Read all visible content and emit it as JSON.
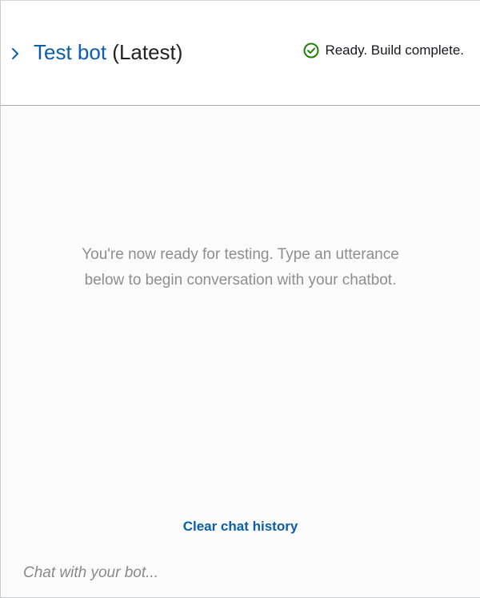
{
  "header": {
    "title_link": "Test bot",
    "title_version": "(Latest)",
    "status_text": "Ready. Build complete.",
    "icons": {
      "expand": "chevron-right-icon",
      "status": "check-circle-icon"
    }
  },
  "body": {
    "empty_message_line1": "You're now ready for testing. Type an utterance",
    "empty_message_line2": "below to begin conversation with your chatbot.",
    "clear_history_label": "Clear chat history"
  },
  "input": {
    "placeholder": "Chat with your bot...",
    "value": ""
  },
  "colors": {
    "link": "#0b5dad",
    "success": "#1d8102",
    "muted_text": "#8c8e91",
    "background": "#fcfbfc",
    "header_background": "#ffffff"
  }
}
